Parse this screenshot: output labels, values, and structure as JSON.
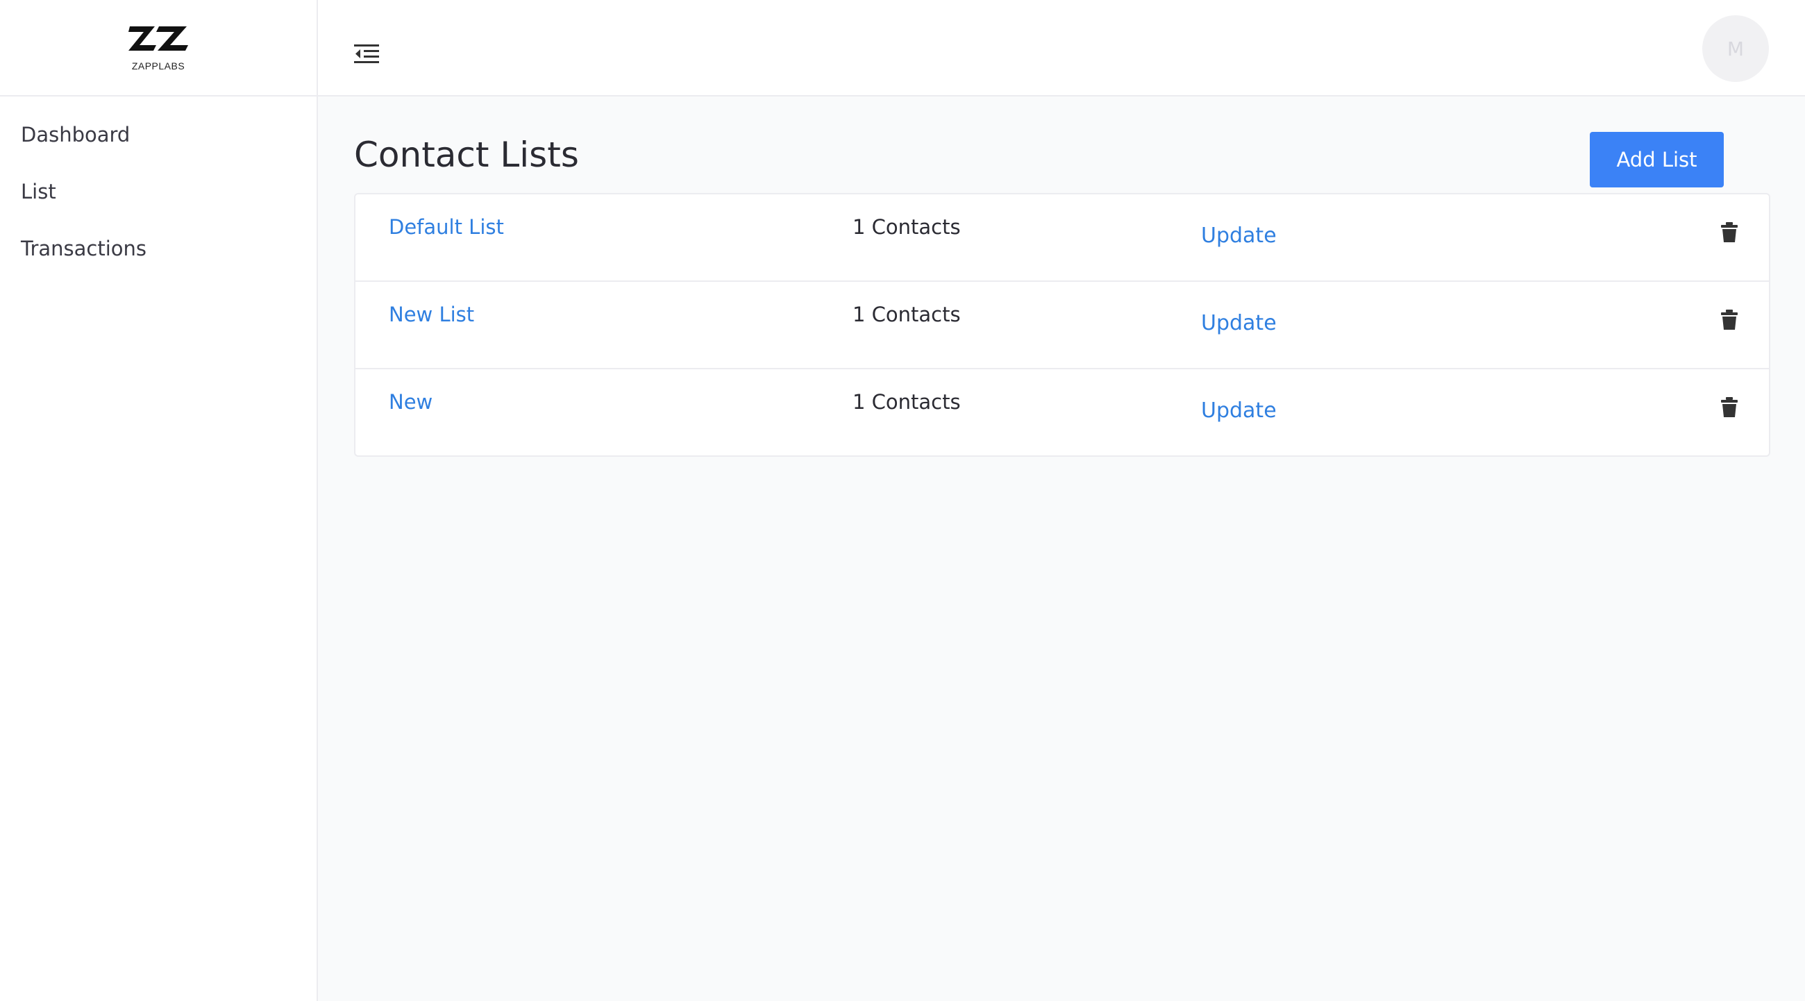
{
  "brand": {
    "logo_text": "ZAPPLABS"
  },
  "sidebar": {
    "items": [
      {
        "label": "Dashboard"
      },
      {
        "label": "List"
      },
      {
        "label": "Transactions"
      }
    ]
  },
  "topbar": {
    "menu_icon": "menu-collapse-icon",
    "avatar_initial": "M"
  },
  "main": {
    "title": "Contact Lists",
    "add_button_label": "Add List",
    "lists": [
      {
        "name": "Default List",
        "count": "1 Contacts",
        "action": "Update"
      },
      {
        "name": "New List",
        "count": "1 Contacts",
        "action": "Update"
      },
      {
        "name": "New",
        "count": "1 Contacts",
        "action": "Update"
      }
    ]
  },
  "colors": {
    "accent": "#3b82f6",
    "link": "#2f7fe0",
    "background": "#f9fafb",
    "border": "#ececf0"
  }
}
